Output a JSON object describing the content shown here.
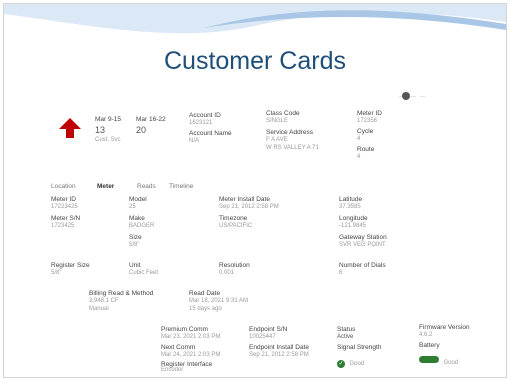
{
  "slide": {
    "title": "Customer Cards"
  },
  "summary": [
    {
      "label": "Mar 9-15",
      "count": "13",
      "sub": "Cust. Svc"
    },
    {
      "label": "Mar 16-22",
      "count": "20",
      "sub": ""
    }
  ],
  "account": {
    "label": "Account ID",
    "value": "1623121",
    "sub_label": "Account Name",
    "sub_value": "N/A"
  },
  "class_code": {
    "label": "Class Code",
    "value": "SINGLE"
  },
  "service_address": {
    "label": "Service Address",
    "line1": "F   A    AVE",
    "line2": "W   RS VALLEY  A   71"
  },
  "meter_id_top": {
    "label": "Meter ID",
    "value": "172356"
  },
  "cycle": {
    "label": "Cycle",
    "value": "4"
  },
  "route": {
    "label": "Route",
    "value": "4"
  },
  "tabs": [
    {
      "label": "Location"
    },
    {
      "label": "Meter"
    },
    {
      "label": "Reads"
    },
    {
      "label": "Timeline"
    }
  ],
  "details": {
    "meter_id": {
      "label": "Meter ID",
      "value": "17223425"
    },
    "meter_sn": {
      "label": "Meter S/N",
      "value": "1723425"
    },
    "model": {
      "label": "Model",
      "value": "25"
    },
    "make": {
      "label": "Make",
      "value": "BADGER"
    },
    "size": {
      "label": "Size",
      "value": "5/8\""
    },
    "install": {
      "label": "Meter Install Date",
      "value": "Sep 21, 2012 2:58 PM"
    },
    "timezone": {
      "label": "Timezone",
      "value": "US/PACIFIC"
    },
    "latitude": {
      "label": "Latitude",
      "value": "37.3585"
    },
    "longitude": {
      "label": "Longitude",
      "value": "-121.9845"
    },
    "gateway": {
      "label": "Gateway Station",
      "value": "SVR VEG POINT"
    },
    "register": {
      "label": "Register Size",
      "value": "5/8\""
    },
    "unit": {
      "label": "Unit",
      "value": "Cubic Feet"
    },
    "resolution": {
      "label": "Resolution",
      "value": "0.001"
    },
    "dials": {
      "label": "Number of Dials",
      "value": "6"
    },
    "billing": {
      "label": "Billing Read & Method",
      "value": "3,948.1 CF",
      "sub": "Manual"
    },
    "read_date": {
      "label": "Read Date",
      "value": "Mar 18, 2021 9:31 AM",
      "sub": "15 days ago"
    },
    "premium": {
      "label": "Premium Comm",
      "value": "Mar 23, 2021 2:03 PM"
    },
    "endpoint_sn": {
      "label": "Endpoint S/N",
      "value": "10025447"
    },
    "status": {
      "label": "Status",
      "value": "Active"
    },
    "firmware": {
      "label": "Firmware Version",
      "value": "4.6.2"
    },
    "next_comm": {
      "label": "Next Comm",
      "value": "Mar 24, 2021 2:03 PM"
    },
    "endpoint_install": {
      "label": "Endpoint Install Date",
      "value": "Sep 21, 2012 2:58 PM"
    },
    "signal": {
      "label": "Signal Strength",
      "value": "Good"
    },
    "battery": {
      "label": "Battery",
      "value": "Good"
    },
    "interface": {
      "label": "Register Interface",
      "value": "Encoder"
    }
  },
  "colors": {
    "title": "#1f4e79",
    "arrow": "#c00000",
    "ok": "#2e7d32"
  }
}
